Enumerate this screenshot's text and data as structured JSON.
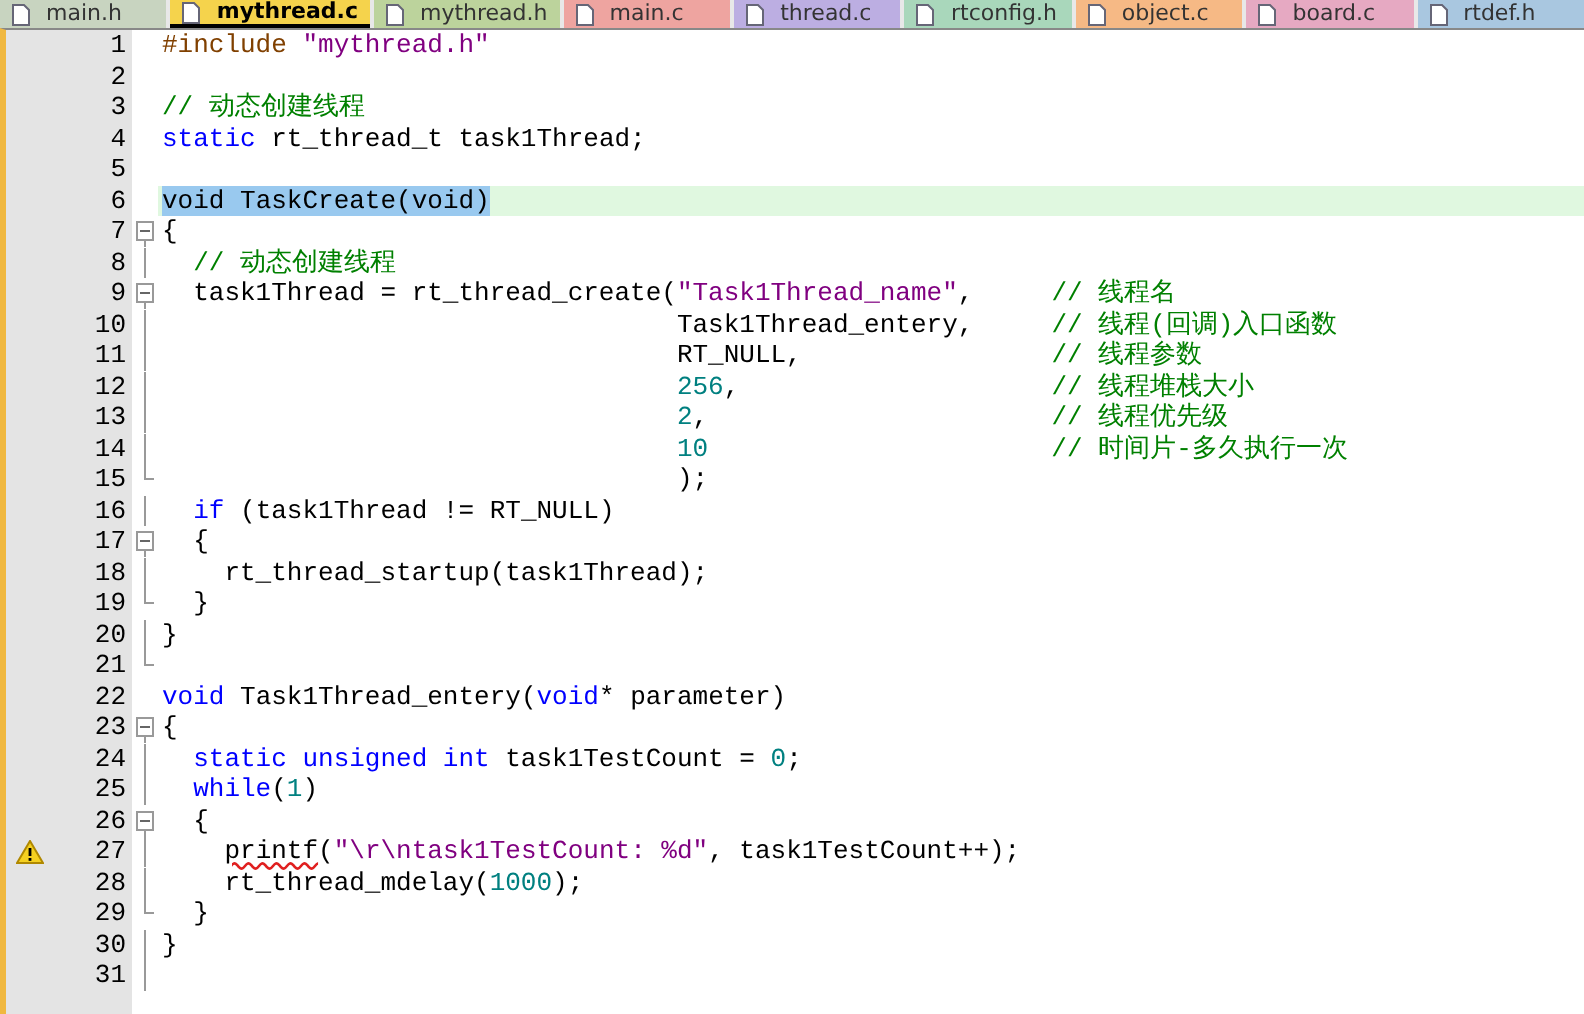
{
  "tabs": [
    {
      "label": "main.h",
      "selected": false,
      "color": "#c8d4c0"
    },
    {
      "label": "mythread.c",
      "selected": true,
      "color": "#f5d34c"
    },
    {
      "label": "mythread.h",
      "selected": false,
      "color": "#bcd39c"
    },
    {
      "label": "main.c",
      "selected": false,
      "color": "#eea4a0"
    },
    {
      "label": "thread.c",
      "selected": false,
      "color": "#bcaee2"
    },
    {
      "label": "rtconfig.h",
      "selected": false,
      "color": "#a9d7bb"
    },
    {
      "label": "object.c",
      "selected": false,
      "color": "#f6b985"
    },
    {
      "label": "board.c",
      "selected": false,
      "color": "#e6a9c2"
    },
    {
      "label": "rtdef.h",
      "selected": false,
      "color": "#a9c7e0"
    }
  ],
  "lines": [
    {
      "number": "1",
      "foldable": false,
      "fold_end": false,
      "in_fold": false,
      "current": false,
      "selected": false,
      "warning": false,
      "tokens": [
        {
          "kind": "pre",
          "text": "#include "
        },
        {
          "kind": "str",
          "text": "\"mythread.h\""
        }
      ]
    },
    {
      "number": "2",
      "foldable": false,
      "fold_end": false,
      "in_fold": false,
      "current": false,
      "warning": false
    },
    {
      "number": "3",
      "foldable": false,
      "fold_end": false,
      "in_fold": false,
      "current": false,
      "selected": false,
      "warning": false,
      "tokens": [
        {
          "kind": "com",
          "text": "// 动态创建线程"
        }
      ]
    },
    {
      "number": "4",
      "foldable": false,
      "fold_end": false,
      "in_fold": false,
      "current": false,
      "selected": false,
      "warning": false,
      "tokens": [
        {
          "kind": "kw",
          "text": "static"
        },
        {
          "kind": "id",
          "text": " rt_thread_t task1Thread;"
        }
      ]
    },
    {
      "number": "5",
      "foldable": false,
      "fold_end": false,
      "in_fold": false,
      "current": false,
      "warning": false
    },
    {
      "number": "6",
      "foldable": false,
      "fold_end": false,
      "in_fold": false,
      "current": true,
      "selected": true,
      "warning": false,
      "tokens": [
        {
          "kind": "kw",
          "text": "void"
        },
        {
          "kind": "id",
          "text": " TaskCreate("
        },
        {
          "kind": "kw",
          "text": "void"
        },
        {
          "kind": "id",
          "text": ")"
        }
      ]
    },
    {
      "number": "7",
      "foldable": true,
      "fold_end": false,
      "in_fold": false,
      "current": false,
      "selected": false,
      "warning": false,
      "tokens": [
        {
          "kind": "id",
          "text": "{"
        }
      ]
    },
    {
      "number": "8",
      "foldable": false,
      "fold_end": false,
      "in_fold": true,
      "current": false,
      "selected": false,
      "warning": false,
      "tokens": [
        {
          "kind": "com",
          "text": "  // 动态创建线程"
        }
      ]
    },
    {
      "number": "9",
      "foldable": true,
      "fold_end": false,
      "in_fold": true,
      "current": false,
      "selected": false,
      "warning": false,
      "tokens": [
        {
          "kind": "id",
          "text": "  task1Thread = rt_thread_create("
        },
        {
          "kind": "str",
          "text": "\"Task1Thread_name\""
        },
        {
          "kind": "id",
          "text": ",     "
        },
        {
          "kind": "com",
          "text": "// 线程名"
        }
      ]
    },
    {
      "number": "10",
      "foldable": false,
      "fold_end": false,
      "in_fold": true,
      "current": false,
      "selected": false,
      "warning": false,
      "tokens": [
        {
          "kind": "id",
          "text": "                                 Task1Thread_entery,     "
        },
        {
          "kind": "com",
          "text": "// 线程(回调)入口函数"
        }
      ]
    },
    {
      "number": "11",
      "foldable": false,
      "fold_end": false,
      "in_fold": true,
      "current": false,
      "selected": false,
      "warning": false,
      "tokens": [
        {
          "kind": "id",
          "text": "                                 RT_NULL,                "
        },
        {
          "kind": "com",
          "text": "// 线程参数"
        }
      ]
    },
    {
      "number": "12",
      "foldable": false,
      "fold_end": false,
      "in_fold": true,
      "current": false,
      "selected": false,
      "warning": false,
      "tokens": [
        {
          "kind": "num",
          "text": "                                 256"
        },
        {
          "kind": "id",
          "text": ",                    "
        },
        {
          "kind": "com",
          "text": "// 线程堆栈大小"
        }
      ]
    },
    {
      "number": "13",
      "foldable": false,
      "fold_end": false,
      "in_fold": true,
      "current": false,
      "selected": false,
      "warning": false,
      "tokens": [
        {
          "kind": "num",
          "text": "                                 2"
        },
        {
          "kind": "id",
          "text": ",                      "
        },
        {
          "kind": "com",
          "text": "// 线程优先级"
        }
      ]
    },
    {
      "number": "14",
      "foldable": false,
      "fold_end": false,
      "in_fold": true,
      "current": false,
      "selected": false,
      "warning": false,
      "tokens": [
        {
          "kind": "num",
          "text": "                                 10"
        },
        {
          "kind": "com",
          "text": "                      // 时间片-多久执行一次"
        }
      ]
    },
    {
      "number": "15",
      "foldable": false,
      "fold_end": true,
      "in_fold": true,
      "current": false,
      "selected": false,
      "warning": false,
      "tokens": [
        {
          "kind": "id",
          "text": "                                 );"
        }
      ]
    },
    {
      "number": "16",
      "foldable": false,
      "fold_end": false,
      "in_fold": true,
      "current": false,
      "selected": false,
      "warning": false,
      "tokens": [
        {
          "kind": "kw",
          "text": "  if"
        },
        {
          "kind": "id",
          "text": " (task1Thread != RT_NULL)"
        }
      ]
    },
    {
      "number": "17",
      "foldable": true,
      "fold_end": false,
      "in_fold": true,
      "current": false,
      "selected": false,
      "warning": false,
      "tokens": [
        {
          "kind": "id",
          "text": "  {"
        }
      ]
    },
    {
      "number": "18",
      "foldable": false,
      "fold_end": false,
      "in_fold": true,
      "current": false,
      "selected": false,
      "warning": false,
      "tokens": [
        {
          "kind": "id",
          "text": "    rt_thread_startup(task1Thread);"
        }
      ]
    },
    {
      "number": "19",
      "foldable": false,
      "fold_end": true,
      "in_fold": true,
      "current": false,
      "selected": false,
      "warning": false,
      "tokens": [
        {
          "kind": "id",
          "text": "  }"
        }
      ]
    },
    {
      "number": "20",
      "foldable": false,
      "fold_end": false,
      "in_fold": true,
      "current": false,
      "selected": false,
      "warning": false,
      "tokens": [
        {
          "kind": "id",
          "text": "}"
        }
      ]
    },
    {
      "number": "21",
      "foldable": false,
      "fold_end": true,
      "in_fold": true,
      "current": false,
      "warning": false
    },
    {
      "number": "22",
      "foldable": false,
      "fold_end": false,
      "in_fold": false,
      "current": false,
      "selected": false,
      "warning": false,
      "tokens": [
        {
          "kind": "kw",
          "text": "void"
        },
        {
          "kind": "id",
          "text": " Task1Thread_entery("
        },
        {
          "kind": "kw",
          "text": "void"
        },
        {
          "kind": "id",
          "text": "* parameter)"
        }
      ]
    },
    {
      "number": "23",
      "foldable": true,
      "fold_end": false,
      "in_fold": false,
      "current": false,
      "selected": false,
      "warning": false,
      "tokens": [
        {
          "kind": "id",
          "text": "{"
        }
      ]
    },
    {
      "number": "24",
      "foldable": false,
      "fold_end": false,
      "in_fold": true,
      "current": false,
      "selected": false,
      "warning": false,
      "tokens": [
        {
          "kind": "kw",
          "text": "  static unsigned int"
        },
        {
          "kind": "id",
          "text": " task1TestCount = "
        },
        {
          "kind": "num",
          "text": "0"
        },
        {
          "kind": "id",
          "text": ";"
        }
      ]
    },
    {
      "number": "25",
      "foldable": false,
      "fold_end": false,
      "in_fold": true,
      "current": false,
      "selected": false,
      "warning": false,
      "tokens": [
        {
          "kind": "kw",
          "text": "  while"
        },
        {
          "kind": "id",
          "text": "("
        },
        {
          "kind": "num",
          "text": "1"
        },
        {
          "kind": "id",
          "text": ")"
        }
      ]
    },
    {
      "number": "26",
      "foldable": true,
      "fold_end": false,
      "in_fold": true,
      "current": false,
      "selected": false,
      "warning": false,
      "tokens": [
        {
          "kind": "id",
          "text": "  {"
        }
      ]
    },
    {
      "number": "27",
      "foldable": false,
      "fold_end": false,
      "in_fold": true,
      "current": false,
      "selected": false,
      "warning": true,
      "tokens": [
        {
          "kind": "err",
          "text": "    printf"
        },
        {
          "kind": "id",
          "text": "("
        },
        {
          "kind": "str",
          "text": "\"\\r\\ntask1TestCount: %d\""
        },
        {
          "kind": "id",
          "text": ", task1TestCount++);"
        }
      ]
    },
    {
      "number": "28",
      "foldable": false,
      "fold_end": false,
      "in_fold": true,
      "current": false,
      "selected": false,
      "warning": false,
      "tokens": [
        {
          "kind": "id",
          "text": "    rt_thread_mdelay("
        },
        {
          "kind": "num",
          "text": "1000"
        },
        {
          "kind": "id",
          "text": ");"
        }
      ]
    },
    {
      "number": "29",
      "foldable": false,
      "fold_end": true,
      "in_fold": true,
      "current": false,
      "selected": false,
      "warning": false,
      "tokens": [
        {
          "kind": "id",
          "text": "  }"
        }
      ]
    },
    {
      "number": "30",
      "foldable": false,
      "fold_end": false,
      "in_fold": true,
      "current": false,
      "selected": false,
      "warning": false,
      "tokens": [
        {
          "kind": "id",
          "text": "}"
        }
      ]
    },
    {
      "number": "31",
      "foldable": false,
      "fold_end": false,
      "in_fold": true,
      "current": false,
      "warning": false
    }
  ]
}
